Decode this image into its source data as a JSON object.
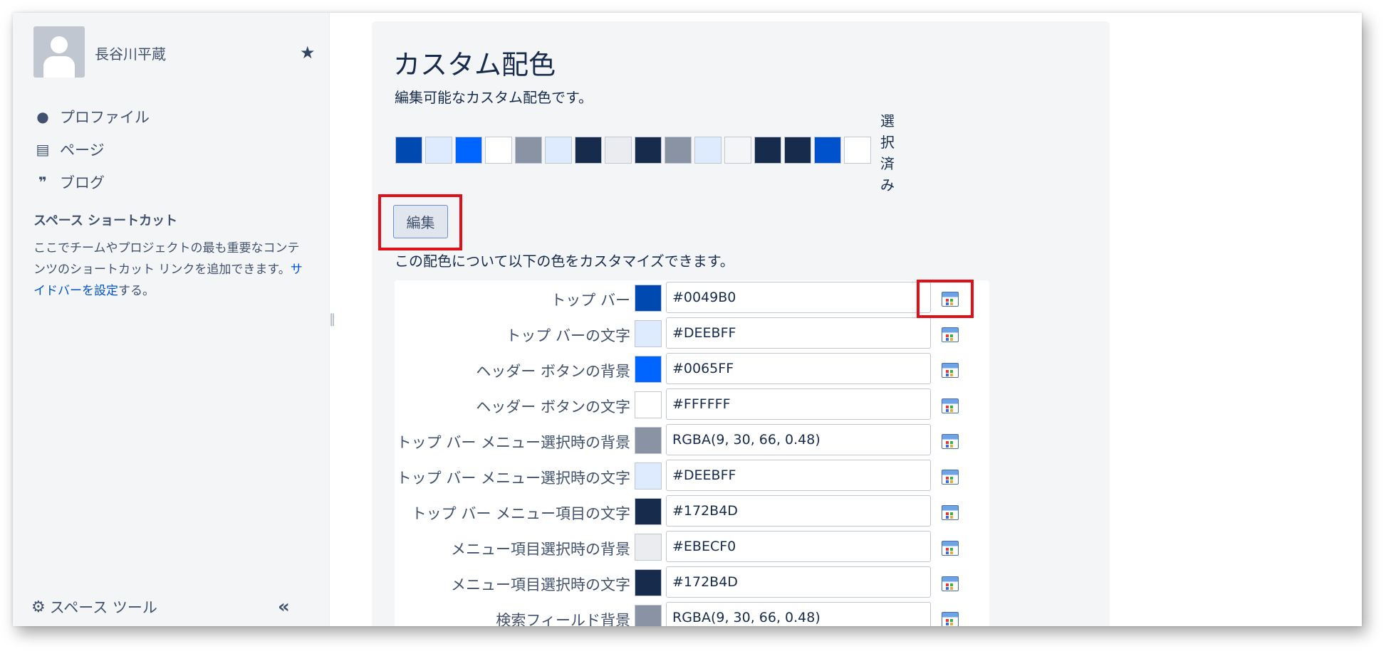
{
  "sidebar": {
    "user_name": "長谷川平蔵",
    "nav": [
      {
        "label": "プロファイル",
        "icon": "person-icon"
      },
      {
        "label": "ページ",
        "icon": "page-icon"
      },
      {
        "label": "ブログ",
        "icon": "quote-icon"
      }
    ],
    "shortcut_title": "スペース ショートカット",
    "shortcut_desc_1": "ここでチームやプロジェクトの最も重要なコンテンツのショートカット リンクを追加できます。",
    "shortcut_link": "サイドバーを設定",
    "shortcut_desc_2": "する。",
    "space_tools": "スペース ツール"
  },
  "main": {
    "title": "カスタム配色",
    "description": "編集可能なカスタム配色です。",
    "swatches": [
      "#0049B0",
      "#DEEBFF",
      "#0065FF",
      "#FFFFFF",
      "#8993A4",
      "#DEEBFF",
      "#172B4D",
      "#EBECF0",
      "#172B4D",
      "#8993A4",
      "#DEEBFF",
      "#F4F5F7",
      "#172B4D",
      "#172B4D",
      "#0052CC",
      "#FFFFFF"
    ],
    "selected_label": "選択済み",
    "edit_button": "編集",
    "customize_text": "この配色について以下の色をカスタマイズできます。",
    "fields": [
      {
        "label": "トップ バー",
        "value": "#0049B0",
        "color": "#0049B0"
      },
      {
        "label": "トップ バーの文字",
        "value": "#DEEBFF",
        "color": "#DEEBFF"
      },
      {
        "label": "ヘッダー ボタンの背景",
        "value": "#0065FF",
        "color": "#0065FF"
      },
      {
        "label": "ヘッダー ボタンの文字",
        "value": "#FFFFFF",
        "color": "#FFFFFF"
      },
      {
        "label": "トップ バー メニュー選択時の背景",
        "value": "RGBA(9, 30, 66, 0.48)",
        "color": "#8993A4"
      },
      {
        "label": "トップ バー メニュー選択時の文字",
        "value": "#DEEBFF",
        "color": "#DEEBFF"
      },
      {
        "label": "トップ バー メニュー項目の文字",
        "value": "#172B4D",
        "color": "#172B4D"
      },
      {
        "label": "メニュー項目選択時の背景",
        "value": "#EBECF0",
        "color": "#EBECF0"
      },
      {
        "label": "メニュー項目選択時の文字",
        "value": "#172B4D",
        "color": "#172B4D"
      },
      {
        "label": "検索フィールド背景",
        "value": "RGBA(9, 30, 66, 0.48)",
        "color": "#8993A4"
      }
    ]
  },
  "colors": {
    "highlight": "#E0101A",
    "link": "#0052CC",
    "sidebar_bg": "#F4F5F7"
  }
}
